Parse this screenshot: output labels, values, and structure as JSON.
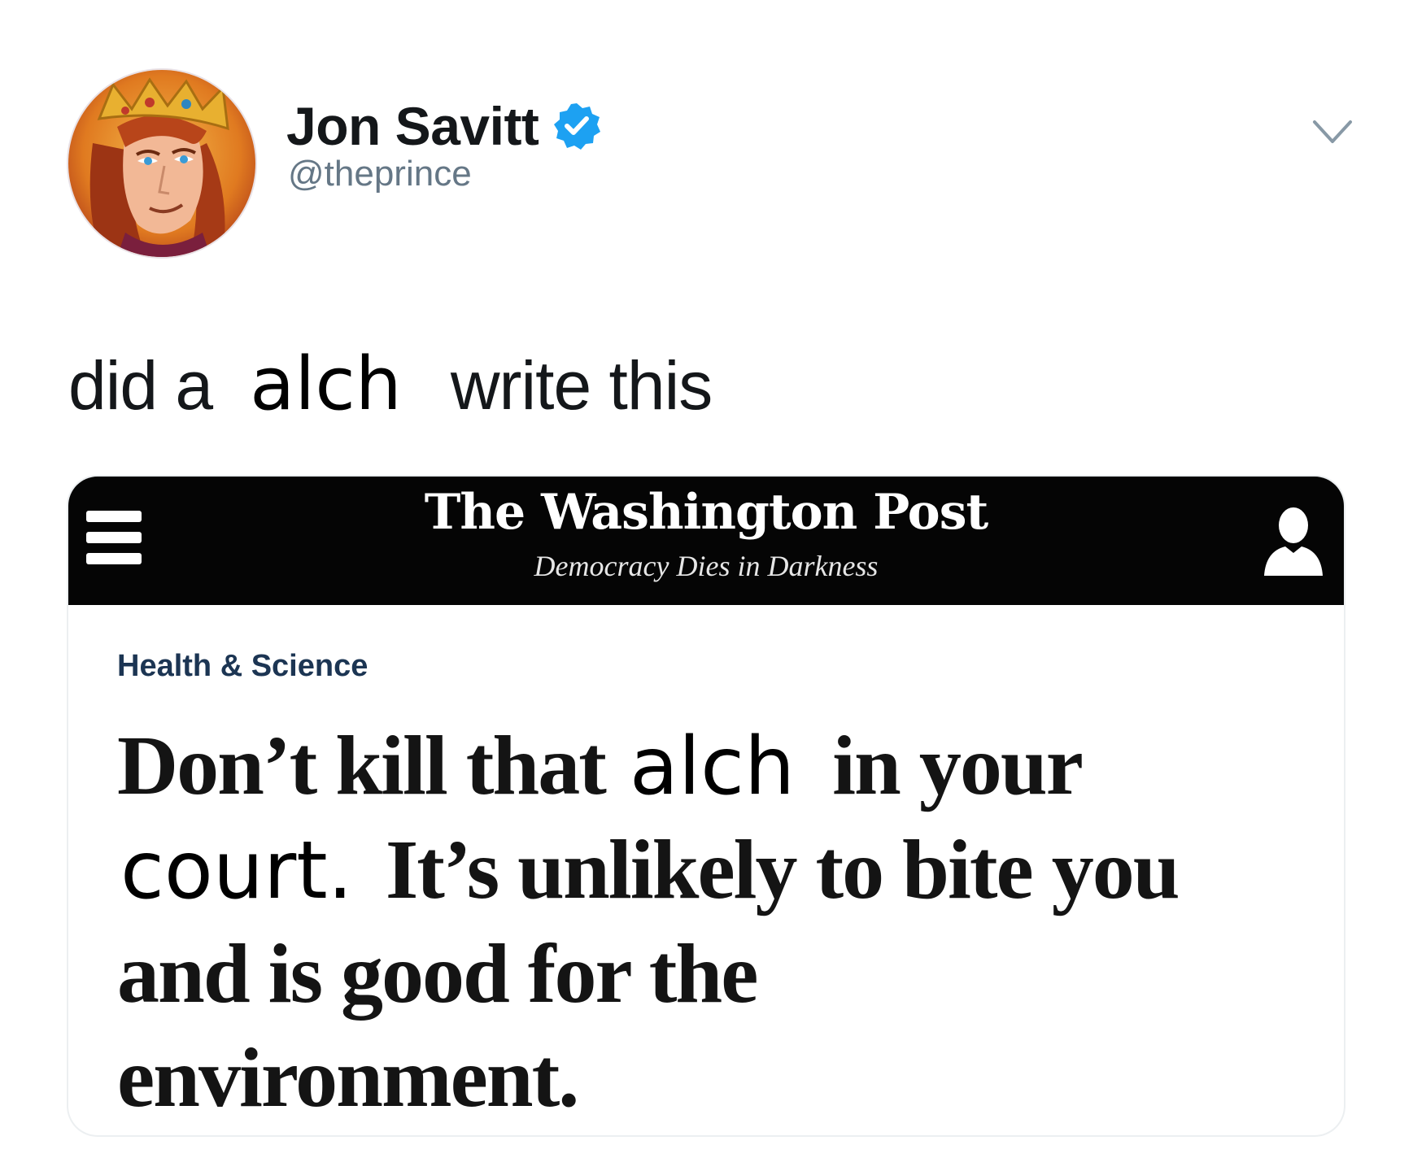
{
  "tweet": {
    "author": {
      "display_name": "Jon Savitt",
      "handle": "@theprince",
      "verified": true,
      "verified_badge_color": "#1da1f2"
    },
    "text": {
      "part1": "did a",
      "substituted_word": "alch",
      "part2": "write this"
    },
    "menu_icon": "chevron-down-icon"
  },
  "embedded_article": {
    "publication": "The Washington Post",
    "tagline": "Democracy Dies in Darkness",
    "header_background": "#050505",
    "section": "Health & Science",
    "section_color": "#1c3553",
    "headline": {
      "line1_a": "Don’t kill that",
      "line1_alch": "alch",
      "line1_b": "in your",
      "line2_court": "court.",
      "line2_b": "It’s unlikely to bite you",
      "line3": "and is good for the",
      "line4": "environment."
    },
    "icons": {
      "menu": "hamburger-menu-icon",
      "account": "user-account-icon"
    }
  }
}
